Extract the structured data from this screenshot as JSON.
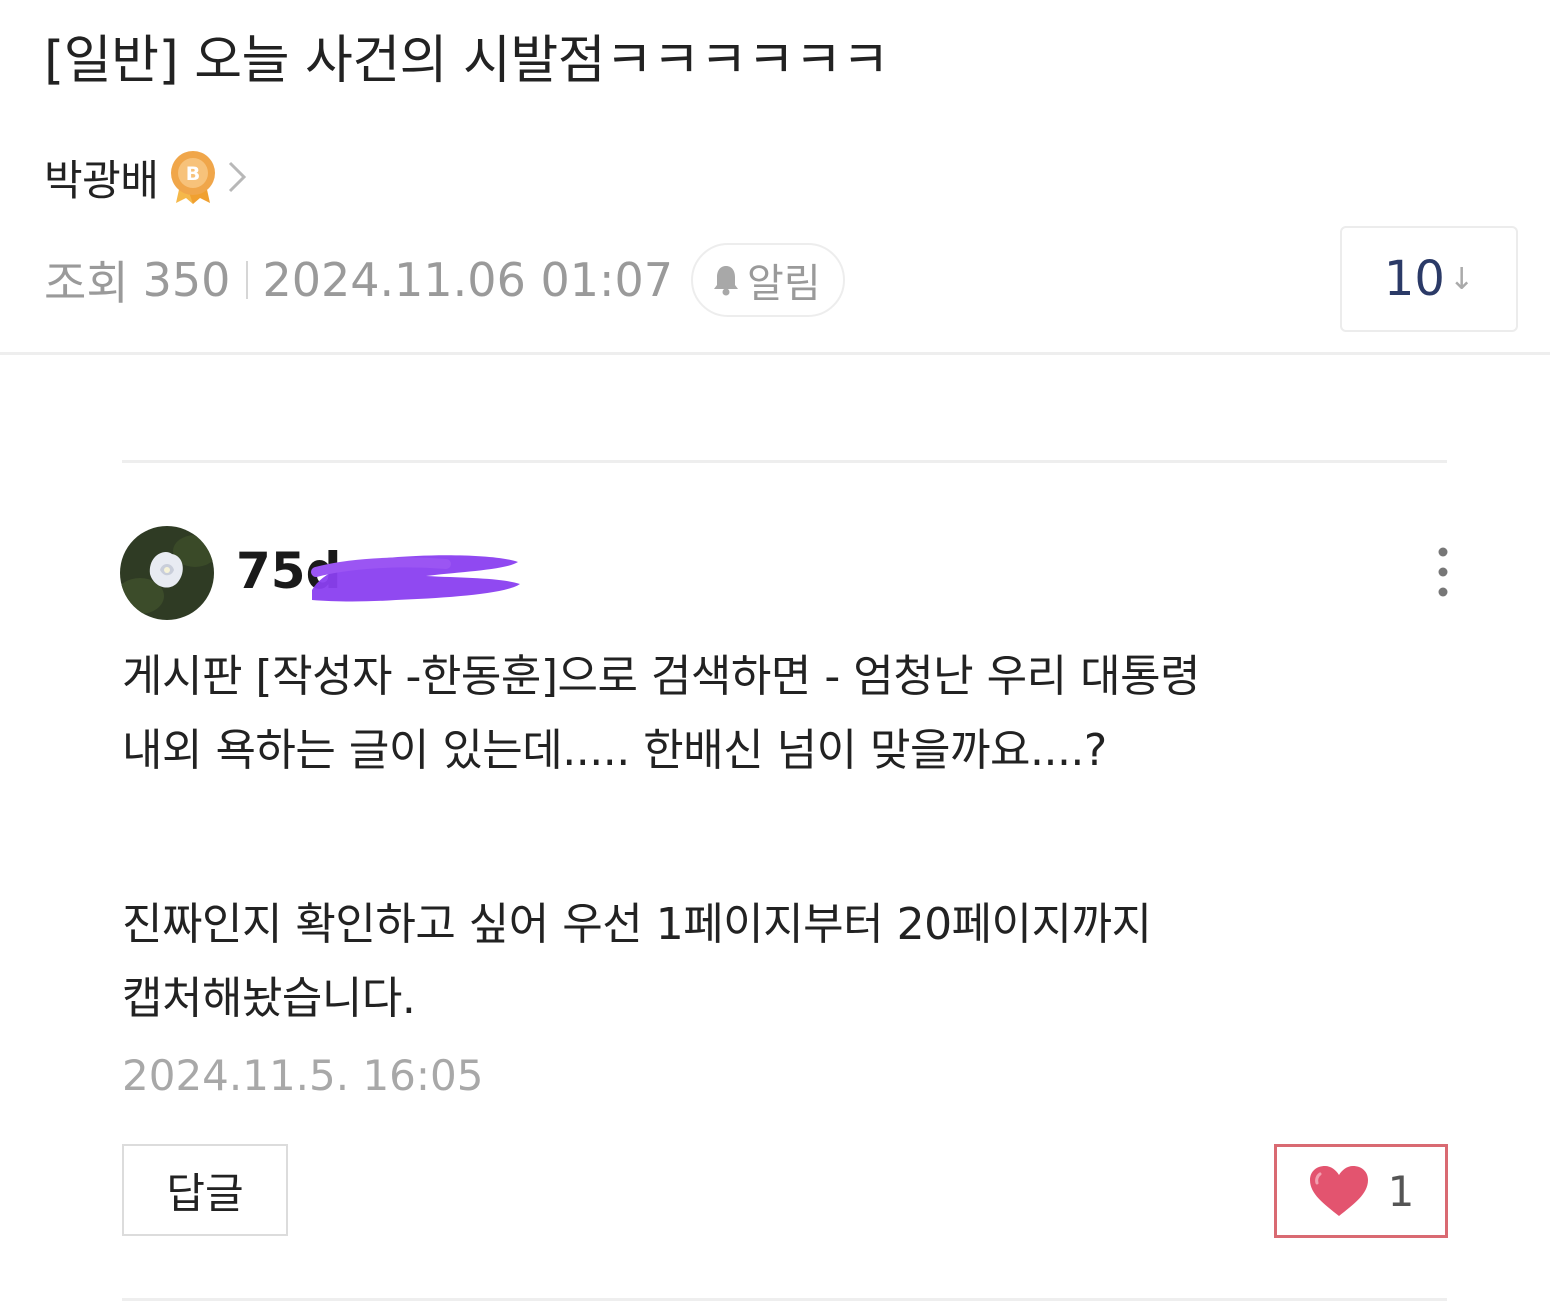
{
  "post": {
    "title": "[일반] 오늘 사건의 시발점ㅋㅋㅋㅋㅋㅋ",
    "author": "박광배",
    "author_badge_letter": "B",
    "views_label": "조회",
    "views_count": "350",
    "datetime": "2024.11.06 01:07",
    "alarm_label": "알림",
    "sort_value": "10",
    "sort_arrow": "↓"
  },
  "comment": {
    "nickname": "75d",
    "body_lines": [
      "게시판 [작성자 -한동훈]으로 검색하면 - 엄청난 우리 대통령",
      "내외 욕하는 글이 있는데..... 한배신 넘이 맞을까요....?",
      "진짜인지 확인하고 싶어 우선 1페이지부터 20페이지까지",
      "캡처해놨습니다."
    ],
    "date": "2024.11.5. 16:05",
    "reply_label": "답글",
    "like_count": "1"
  },
  "icons": {
    "badge": "bronze-medal-icon",
    "chevron": "chevron-right-icon",
    "alarm": "bell-icon",
    "more": "more-vertical-icon",
    "like": "heart-icon",
    "redaction": "purple-scribble-redaction"
  },
  "colors": {
    "sort_text": "#2b3a67",
    "meta_text": "#9a9a9a",
    "like_border": "#d96a72",
    "heart": "#e3546f",
    "badge": "#f0a64a",
    "redaction": "#8a3ff0"
  }
}
